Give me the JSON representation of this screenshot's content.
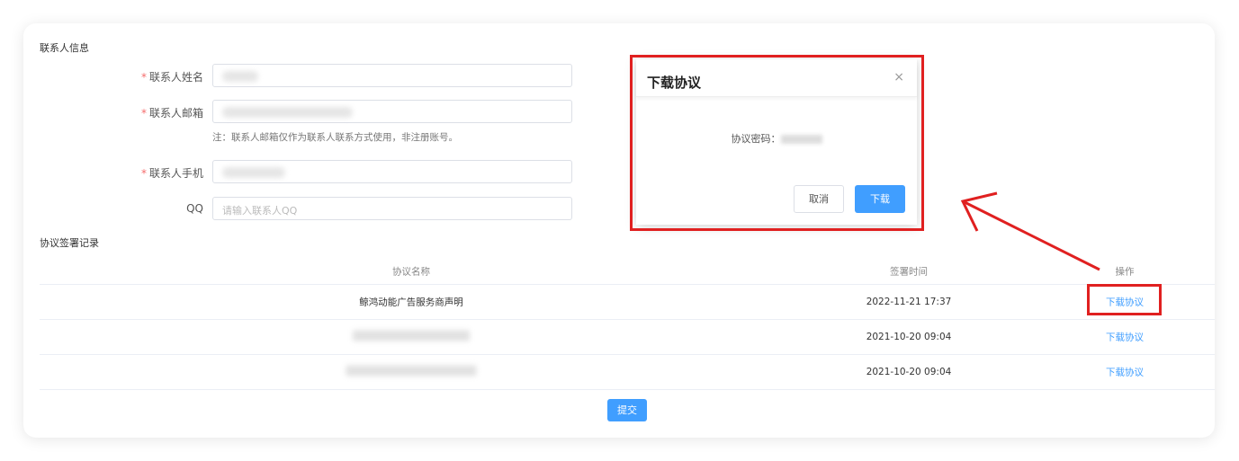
{
  "contact_section": {
    "title": "联系人信息",
    "name_label": "联系人姓名",
    "email_label": "联系人邮箱",
    "email_note": "注：联系人邮箱仅作为联系人联系方式使用，非注册账号。",
    "phone_label": "联系人手机",
    "qq_label": "QQ",
    "qq_placeholder": "请输入联系人QQ"
  },
  "agreement_section": {
    "title": "协议签署记录",
    "columns": [
      "协议名称",
      "签署时间",
      "操作"
    ],
    "rows": [
      {
        "name": "鲸鸿动能广告服务商声明",
        "time": "2022-11-21 17:37",
        "action": "下载协议"
      },
      {
        "name": "",
        "time": "2021-10-20 09:04",
        "action": "下载协议"
      },
      {
        "name": "",
        "time": "2021-10-20 09:04",
        "action": "下载协议"
      }
    ]
  },
  "submit_label": "提交",
  "modal": {
    "title": "下载协议",
    "close_icon": "×",
    "password_label": "协议密码：",
    "cancel_label": "取消",
    "download_label": "下载"
  },
  "colors": {
    "accent": "#409eff",
    "annotation": "#e02020",
    "required": "#f56c6c"
  }
}
